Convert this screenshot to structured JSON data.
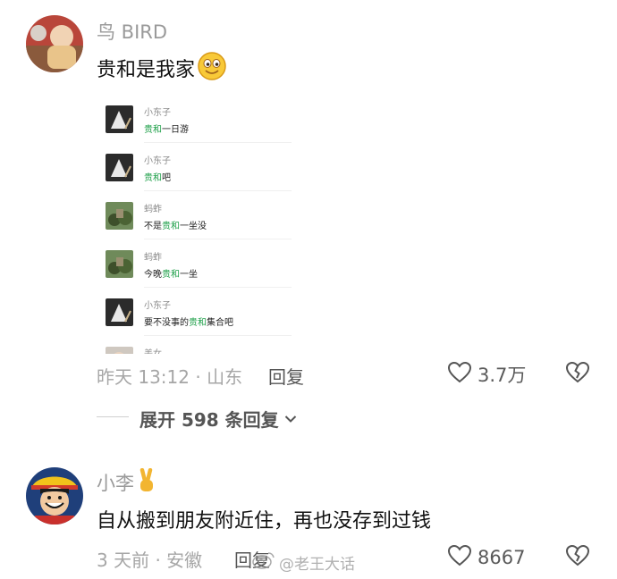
{
  "comments": [
    {
      "username": "鸟 BIRD",
      "text": "贵和是我家",
      "time_location": "昨天 13:12 · 山东",
      "reply_label": "回复",
      "likes": "3.7万",
      "chat_screenshot": [
        {
          "name": "小东子",
          "before": "",
          "highlight": "贵和",
          "after": "一日游"
        },
        {
          "name": "小东子",
          "before": "",
          "highlight": "贵和",
          "after": "吧"
        },
        {
          "name": "蚂蚱",
          "before": "不是",
          "highlight": "贵和",
          "after": "一坐没"
        },
        {
          "name": "蚂蚱",
          "before": "今晚",
          "highlight": "贵和",
          "after": "一坐"
        },
        {
          "name": "小东子",
          "before": "要不没事的",
          "highlight": "贵和",
          "after": "集合吧"
        },
        {
          "name": "美女",
          "before": "",
          "highlight": "",
          "after": ""
        }
      ]
    },
    {
      "username": "小李",
      "text": "自从搬到朋友附近住，再也没存到过钱",
      "time_location": "3 天前 · 安徽",
      "reply_label": "回复",
      "likes": "8667"
    }
  ],
  "expand": {
    "label": "展开 598 条回复"
  },
  "watermark": "@老王大话",
  "colors": {
    "highlight": "#1fa04a",
    "meta": "#a6a6a6"
  }
}
